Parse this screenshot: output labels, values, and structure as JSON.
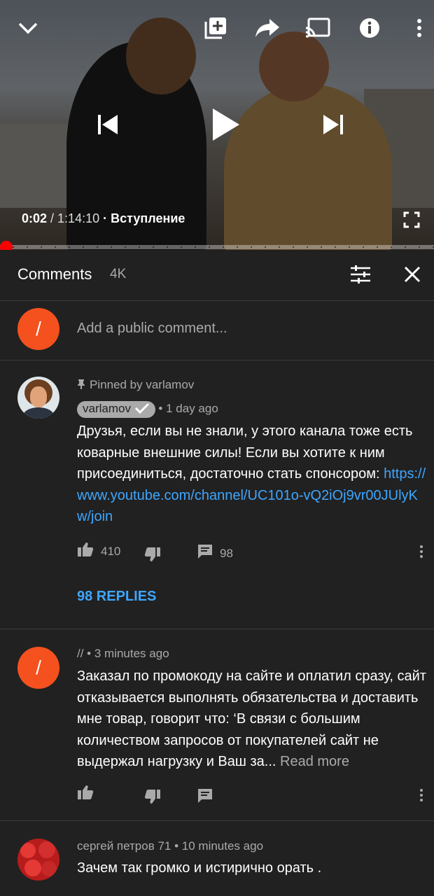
{
  "player": {
    "current_time": "0:02",
    "separator": " / ",
    "duration": "1:14:10",
    "chapter": " · Вступление",
    "progress_fraction": 0.0
  },
  "comments_header": {
    "title": "Comments",
    "count": "4K"
  },
  "add_comment": {
    "avatar_letter": "/",
    "placeholder": "Add a public comment..."
  },
  "comments": [
    {
      "pinned_label": "Pinned by varlamov",
      "author": "varlamov",
      "verified": true,
      "time": "1 day ago",
      "text": "Друзья, если вы не знали, у этого канала тоже есть коварные внешние силы! Если вы хотите к ним присоединиться, достаточно стать спонсором: ",
      "link": "https://www.youtube.com/channel/UC101o-vQ2iOj9vr00JUlyKw/join",
      "likes": "410",
      "replies_count": "98",
      "replies_label": "98 REPLIES"
    },
    {
      "avatar_letter": "/",
      "author": "//",
      "time": "3 minutes ago",
      "text": "Заказал по промокоду на сайте и оплатил сразу, сайт отказывается выполнять обязательства и доставить мне товар, говорит что: ‘В связи с большим количеством запросов от покупателей сайт не выдержал нагрузку и Ваш за...",
      "read_more": " Read more"
    },
    {
      "author": "сергей петров 71",
      "time": "10 minutes ago",
      "text": "Зачем так громко и истирично орать ."
    }
  ],
  "meta_separator": " • ",
  "colors": {
    "background": "#212121",
    "accent_red": "#ff0000",
    "link_blue": "#3ea6ff",
    "avatar_orange": "#f4511e"
  }
}
